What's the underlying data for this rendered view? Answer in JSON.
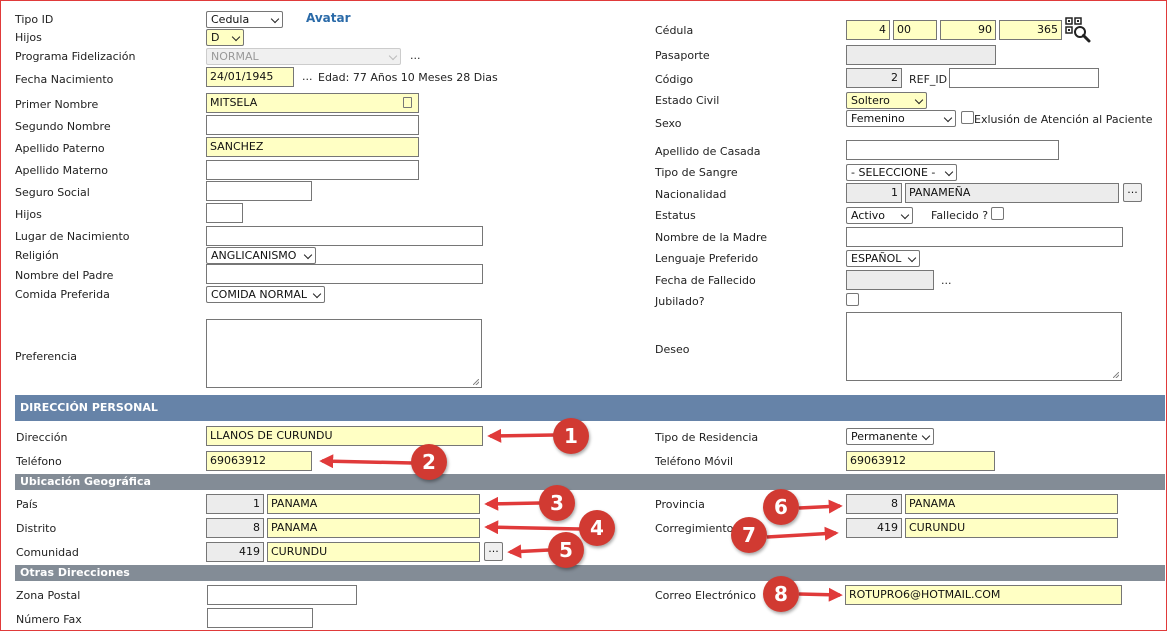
{
  "left": {
    "tipo_id": {
      "label": "Tipo ID",
      "value": "Cedula"
    },
    "avatar_link": "Avatar",
    "hijos_top": {
      "label": "Hijos",
      "value": "D"
    },
    "programa": {
      "label": "Programa Fidelización",
      "value": "NORMAL",
      "more": "..."
    },
    "fecha_nac": {
      "label": "Fecha Nacimiento",
      "value": "24/01/1945",
      "more": "...",
      "edad": "Edad: 77 Años 10 Meses 28 Dias"
    },
    "primer_nombre": {
      "label": "Primer Nombre",
      "value": "MITSELA"
    },
    "segundo_nombre": {
      "label": "Segundo Nombre",
      "value": ""
    },
    "apellido_paterno": {
      "label": "Apellido Paterno",
      "value": "SANCHEZ"
    },
    "apellido_materno": {
      "label": "Apellido Materno",
      "value": ""
    },
    "seguro_social": {
      "label": "Seguro Social",
      "value": ""
    },
    "hijos": {
      "label": "Hijos",
      "value": ""
    },
    "lugar_nac": {
      "label": "Lugar de Nacimiento",
      "value": ""
    },
    "religion": {
      "label": "Religión",
      "value": "ANGLICANISMO"
    },
    "nombre_padre": {
      "label": "Nombre del Padre",
      "value": ""
    },
    "comida": {
      "label": "Comida Preferida",
      "value": "COMIDA NORMAL"
    },
    "preferencia": {
      "label": "Preferencia"
    }
  },
  "right": {
    "cedula": {
      "label": "Cédula",
      "parts": [
        "4",
        "00",
        "90",
        "365"
      ]
    },
    "pasaporte": {
      "label": "Pasaporte",
      "value": ""
    },
    "codigo": {
      "label": "Código",
      "value": "2",
      "ref_label": "REF_ID",
      "ref_value": ""
    },
    "estado_civil": {
      "label": "Estado Civil",
      "value": "Soltero"
    },
    "sexo": {
      "label": "Sexo",
      "value": "Femenino",
      "exclusion": "Exlusión de Atención al Paciente"
    },
    "apellido_casada": {
      "label": "Apellido de Casada",
      "value": ""
    },
    "tipo_sangre": {
      "label": "Tipo de Sangre",
      "value": "- SELECCIONE -"
    },
    "nacionalidad": {
      "label": "Nacionalidad",
      "code": "1",
      "value": "PANAMEÑA",
      "more": "..."
    },
    "estatus": {
      "label": "Estatus",
      "value": "Activo",
      "fallecido": "Fallecido ?"
    },
    "nombre_madre": {
      "label": "Nombre de la Madre",
      "value": ""
    },
    "lenguaje": {
      "label": "Lenguaje Preferido",
      "value": "ESPAÑOL"
    },
    "fecha_fallecido": {
      "label": "Fecha de Fallecido",
      "value": "",
      "more": "..."
    },
    "jubilado": {
      "label": "Jubilado?"
    },
    "deseo": {
      "label": "Deseo"
    }
  },
  "direccion_personal": {
    "title": "DIRECCIÓN PERSONAL",
    "direccion": {
      "label": "Dirección",
      "value": "LLANOS DE CURUNDU"
    },
    "telefono": {
      "label": "Teléfono",
      "value": "69063912"
    },
    "tipo_residencia": {
      "label": "Tipo de Residencia",
      "value": "Permanente"
    },
    "telefono_movil": {
      "label": "Teléfono Móvil",
      "value": "69063912"
    }
  },
  "ubicacion": {
    "title": "Ubicación Geográfica",
    "pais": {
      "label": "País",
      "code": "1",
      "value": "PANAMA"
    },
    "distrito": {
      "label": "Distrito",
      "code": "8",
      "value": "PANAMA"
    },
    "comunidad": {
      "label": "Comunidad",
      "code": "419",
      "value": "CURUNDU",
      "more": "..."
    },
    "provincia": {
      "label": "Provincia",
      "code": "8",
      "value": "PANAMA"
    },
    "corregimiento": {
      "label": "Corregimiento",
      "code": "419",
      "value": "CURUNDU"
    }
  },
  "otras": {
    "title": "Otras Direcciones",
    "zona_postal": {
      "label": "Zona Postal",
      "value": ""
    },
    "fax": {
      "label": "Número Fax",
      "value": ""
    },
    "correo": {
      "label": "Correo Electrónico",
      "value": "ROTUPRO6@HOTMAIL.COM"
    }
  },
  "annotations": [
    "1",
    "2",
    "3",
    "4",
    "5",
    "6",
    "7",
    "8"
  ],
  "colors": {
    "highlight": "#ffffc4",
    "section_header": "#6683a8",
    "subsection_header": "#838c96",
    "annotation": "#d13a32",
    "frame": "#e03a3a"
  },
  "icons": {
    "qr_search": "qr-search-icon",
    "arrow": "red-arrow-icon"
  }
}
